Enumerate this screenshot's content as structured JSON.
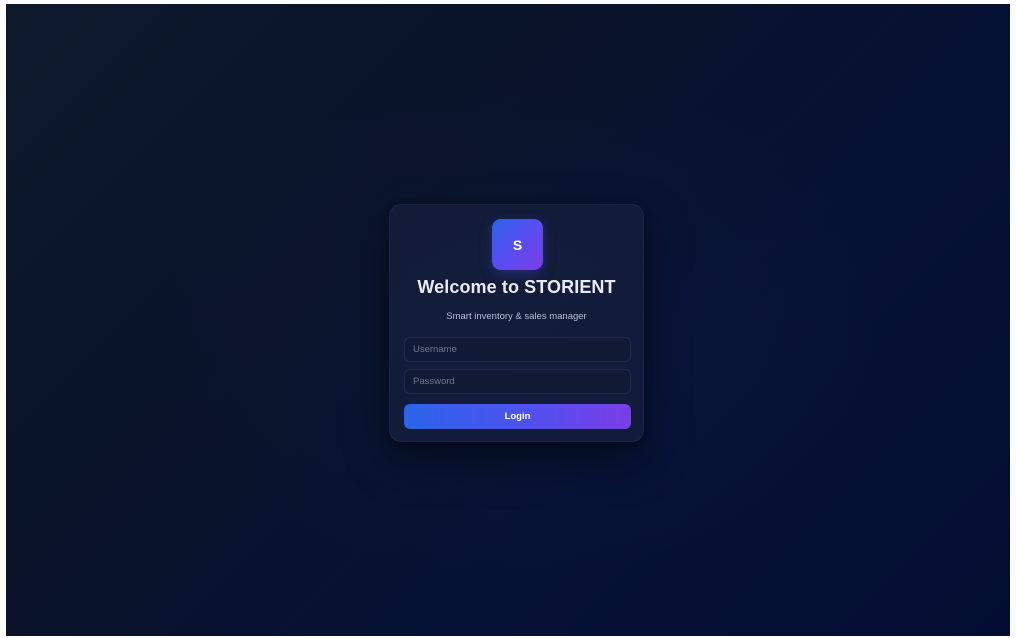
{
  "login": {
    "logo_letter": "S",
    "title": "Welcome to STORIENT",
    "subtitle": "Smart inventory & sales manager",
    "username_placeholder": "Username",
    "password_placeholder": "Password",
    "login_label": "Login"
  },
  "colors": {
    "accent_blue": "#2d63ea",
    "accent_purple": "#7a3ce6",
    "background": "#061235",
    "card": "#161e3c"
  }
}
